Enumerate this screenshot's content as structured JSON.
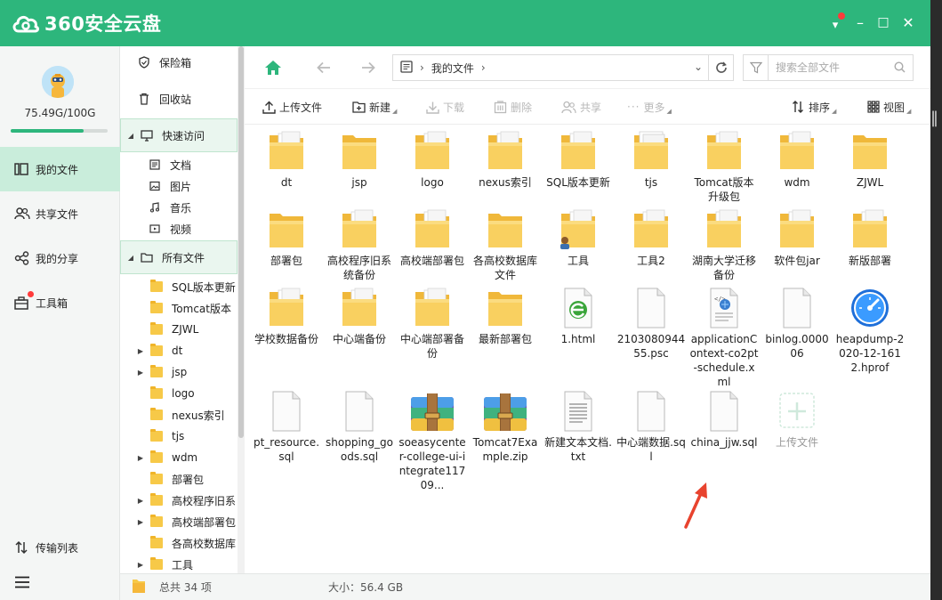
{
  "app": {
    "title": "360安全云盘"
  },
  "window": {
    "min": "–",
    "max": "□",
    "close": "✕",
    "menu": "▾"
  },
  "user": {
    "quota_text": "75.49G/100G",
    "quota_fraction": 0.7549
  },
  "left_nav": {
    "items": [
      {
        "label": "我的文件",
        "icon": "file-icon",
        "active": true
      },
      {
        "label": "共享文件",
        "icon": "users-icon",
        "active": false
      },
      {
        "label": "我的分享",
        "icon": "share-icon",
        "active": false
      },
      {
        "label": "工具箱",
        "icon": "toolbox-icon",
        "active": false
      }
    ],
    "transfer": "传输列表"
  },
  "tree": {
    "top_items": [
      {
        "label": "保险箱",
        "icon": "shield-icon"
      },
      {
        "label": "回收站",
        "icon": "trash-icon"
      }
    ],
    "quick_access": {
      "label": "快速访问",
      "items": [
        {
          "label": "文档",
          "icon": "doc-icon"
        },
        {
          "label": "图片",
          "icon": "image-icon"
        },
        {
          "label": "音乐",
          "icon": "music-icon"
        },
        {
          "label": "视频",
          "icon": "video-icon"
        }
      ]
    },
    "all_files": {
      "label": "所有文件",
      "items": [
        {
          "label": "SQL版本更新",
          "expandable": false
        },
        {
          "label": "Tomcat版本",
          "expandable": false
        },
        {
          "label": "ZJWL",
          "expandable": false
        },
        {
          "label": "dt",
          "expandable": true
        },
        {
          "label": "jsp",
          "expandable": true
        },
        {
          "label": "logo",
          "expandable": false
        },
        {
          "label": "nexus索引",
          "expandable": false
        },
        {
          "label": "tjs",
          "expandable": false
        },
        {
          "label": "wdm",
          "expandable": true
        },
        {
          "label": "部署包",
          "expandable": false
        },
        {
          "label": "高校程序旧系",
          "expandable": true
        },
        {
          "label": "高校端部署包",
          "expandable": true
        },
        {
          "label": "各高校数据库",
          "expandable": false
        },
        {
          "label": "工具",
          "expandable": true
        }
      ]
    }
  },
  "navbar": {
    "path_root": "我的文件",
    "search_placeholder": "搜索全部文件"
  },
  "toolbar": {
    "upload": "上传文件",
    "new": "新建",
    "download": "下载",
    "delete": "删除",
    "share": "共享",
    "more": "更多",
    "sort": "排序",
    "view": "视图",
    "more_dots": "···"
  },
  "files": [
    {
      "name": "dt",
      "type": "folder"
    },
    {
      "name": "jsp",
      "type": "folder-plain"
    },
    {
      "name": "logo",
      "type": "folder"
    },
    {
      "name": "nexus索引",
      "type": "folder"
    },
    {
      "name": "SQL版本更新",
      "type": "folder"
    },
    {
      "name": "tjs",
      "type": "folder-white"
    },
    {
      "name": "Tomcat版本升级包",
      "type": "folder"
    },
    {
      "name": "wdm",
      "type": "folder"
    },
    {
      "name": "ZJWL",
      "type": "folder-plain"
    },
    {
      "name": "部署包",
      "type": "folder-plain"
    },
    {
      "name": "高校程序旧系统备份",
      "type": "folder"
    },
    {
      "name": "高校端部署包",
      "type": "folder"
    },
    {
      "name": "各高校数据库文件",
      "type": "folder-plain"
    },
    {
      "name": "工具",
      "type": "folder-user"
    },
    {
      "name": "工具2",
      "type": "folder"
    },
    {
      "name": "湖南大学迁移备份",
      "type": "folder"
    },
    {
      "name": "软件包jar",
      "type": "folder"
    },
    {
      "name": "新版部署",
      "type": "folder"
    },
    {
      "name": "学校数据备份",
      "type": "folder"
    },
    {
      "name": "中心端备份",
      "type": "folder"
    },
    {
      "name": "中心端部署备份",
      "type": "folder"
    },
    {
      "name": "最新部署包",
      "type": "folder-plain"
    },
    {
      "name": "1.html",
      "type": "html"
    },
    {
      "name": "210308094455.psc",
      "type": "doc"
    },
    {
      "name": "applicationContext-co2pt-schedule.xml",
      "type": "xml"
    },
    {
      "name": "binlog.000006",
      "type": "doc"
    },
    {
      "name": "heapdump-2020-12-1612.hprof",
      "type": "hprof"
    },
    {
      "name": "pt_resource.sql",
      "type": "doc"
    },
    {
      "name": "shopping_goods.sql",
      "type": "doc"
    },
    {
      "name": "soeasycenter-college-ui-integrate11709...",
      "type": "zip"
    },
    {
      "name": "Tomcat7Example.zip",
      "type": "zip"
    },
    {
      "name": "新建文本文档.txt",
      "type": "txt"
    },
    {
      "name": "中心端数据.sql",
      "type": "doc"
    },
    {
      "name": "china_jjw.sql",
      "type": "doc"
    },
    {
      "name": "上传文件",
      "type": "upload"
    }
  ],
  "status": {
    "total": "总共 34 项",
    "size": "大小：56.4 GB"
  },
  "colors": {
    "brand": "#2db67c",
    "active_nav": "#c9eddb",
    "folder": "#f7c948",
    "arrow": "#e8432e"
  }
}
